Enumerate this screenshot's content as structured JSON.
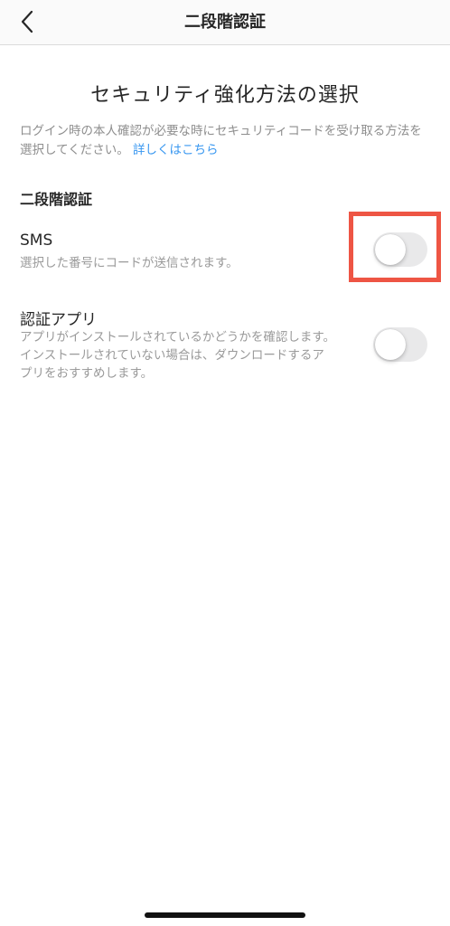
{
  "nav": {
    "title": "二段階認証",
    "back_icon": "chevron-left-icon"
  },
  "main": {
    "heading": "セキュリティ強化方法の選択",
    "description": "ログイン時の本人確認が必要な時にセキュリティコードを受け取る方法を選択してください。",
    "learn_more": "詳しくはこちら",
    "section_title": "二段階認証"
  },
  "options": [
    {
      "title": "SMS",
      "description": "選択した番号にコードが送信されます。",
      "enabled": false
    },
    {
      "title": "認証アプリ",
      "description": "アプリがインストールされているかどうかを確認します。インストールされていない場合は、ダウンロードするアプリをおすすめします。",
      "enabled": false
    }
  ],
  "colors": {
    "link": "#3897f0",
    "highlight": "#ee5544",
    "toggle_off": "#e9e9ea"
  }
}
